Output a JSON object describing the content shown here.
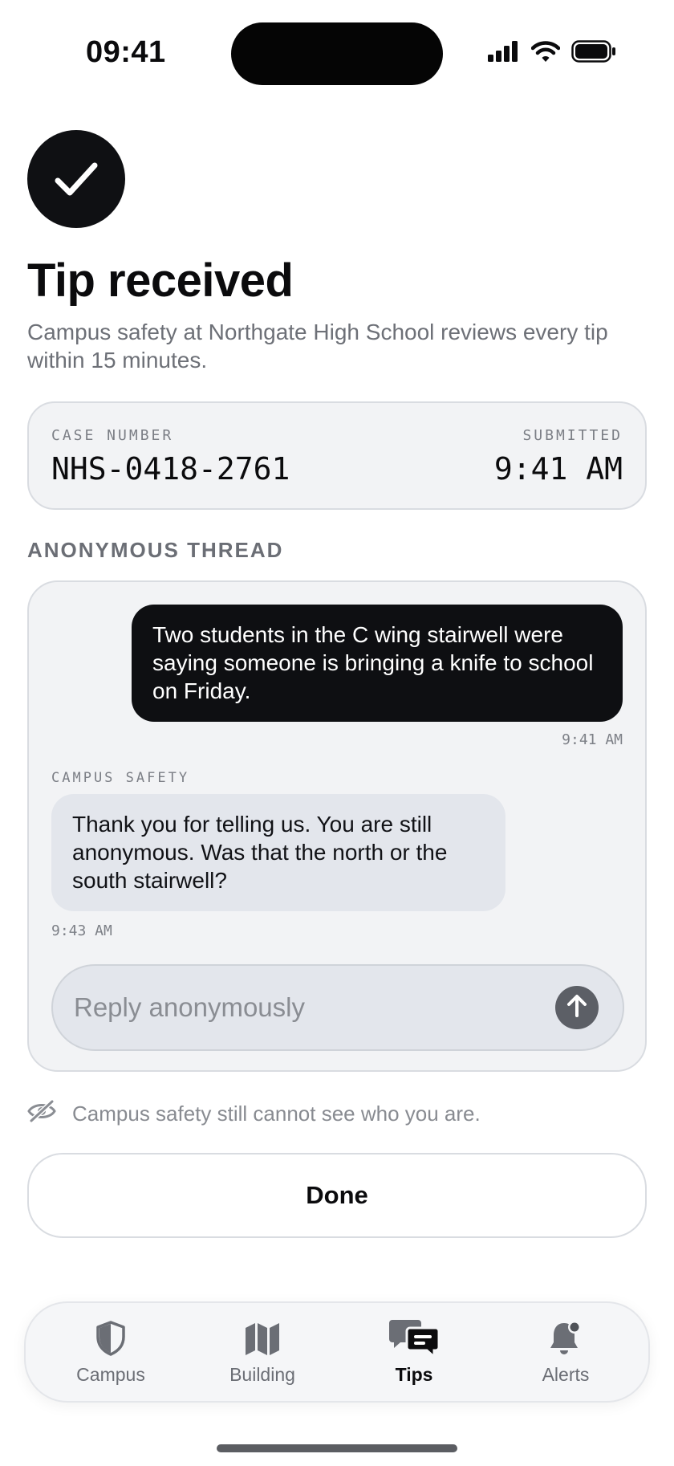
{
  "status_bar": {
    "time": "09:41"
  },
  "header": {
    "title": "Tip received",
    "subtitle": "Campus safety at Northgate High School reviews every tip within 15 minutes.",
    "icon": "checkmark-icon"
  },
  "case": {
    "case_number_label": "CASE NUMBER",
    "case_number": "NHS-0418-2761",
    "submitted_label": "SUBMITTED",
    "submitted_time": "9:41 AM"
  },
  "thread": {
    "section_label": "ANONYMOUS THREAD",
    "messages": [
      {
        "direction": "outgoing",
        "text": "Two students in the C wing stairwell were saying someone is bringing a knife to school on Friday.",
        "time": "9:41 AM"
      },
      {
        "direction": "incoming",
        "sender": "CAMPUS SAFETY",
        "text": "Thank you for telling us. You are still anonymous. Was that the north or the south stairwell?",
        "time": "9:43 AM"
      }
    ],
    "reply_placeholder": "Reply anonymously",
    "reply_value": ""
  },
  "privacy_note": "Campus safety still cannot see who you are.",
  "done_label": "Done",
  "tabs": [
    {
      "label": "Campus",
      "icon": "shield-icon",
      "active": false
    },
    {
      "label": "Building",
      "icon": "map-icon",
      "active": false
    },
    {
      "label": "Tips",
      "icon": "chat-bubbles-icon",
      "active": true
    },
    {
      "label": "Alerts",
      "icon": "bell-icon",
      "active": false
    }
  ],
  "colors": {
    "primary": "#0e0f12",
    "card_background": "#f2f3f5",
    "incoming_bubble": "#e3e6ec",
    "muted_text": "#6d7077"
  }
}
